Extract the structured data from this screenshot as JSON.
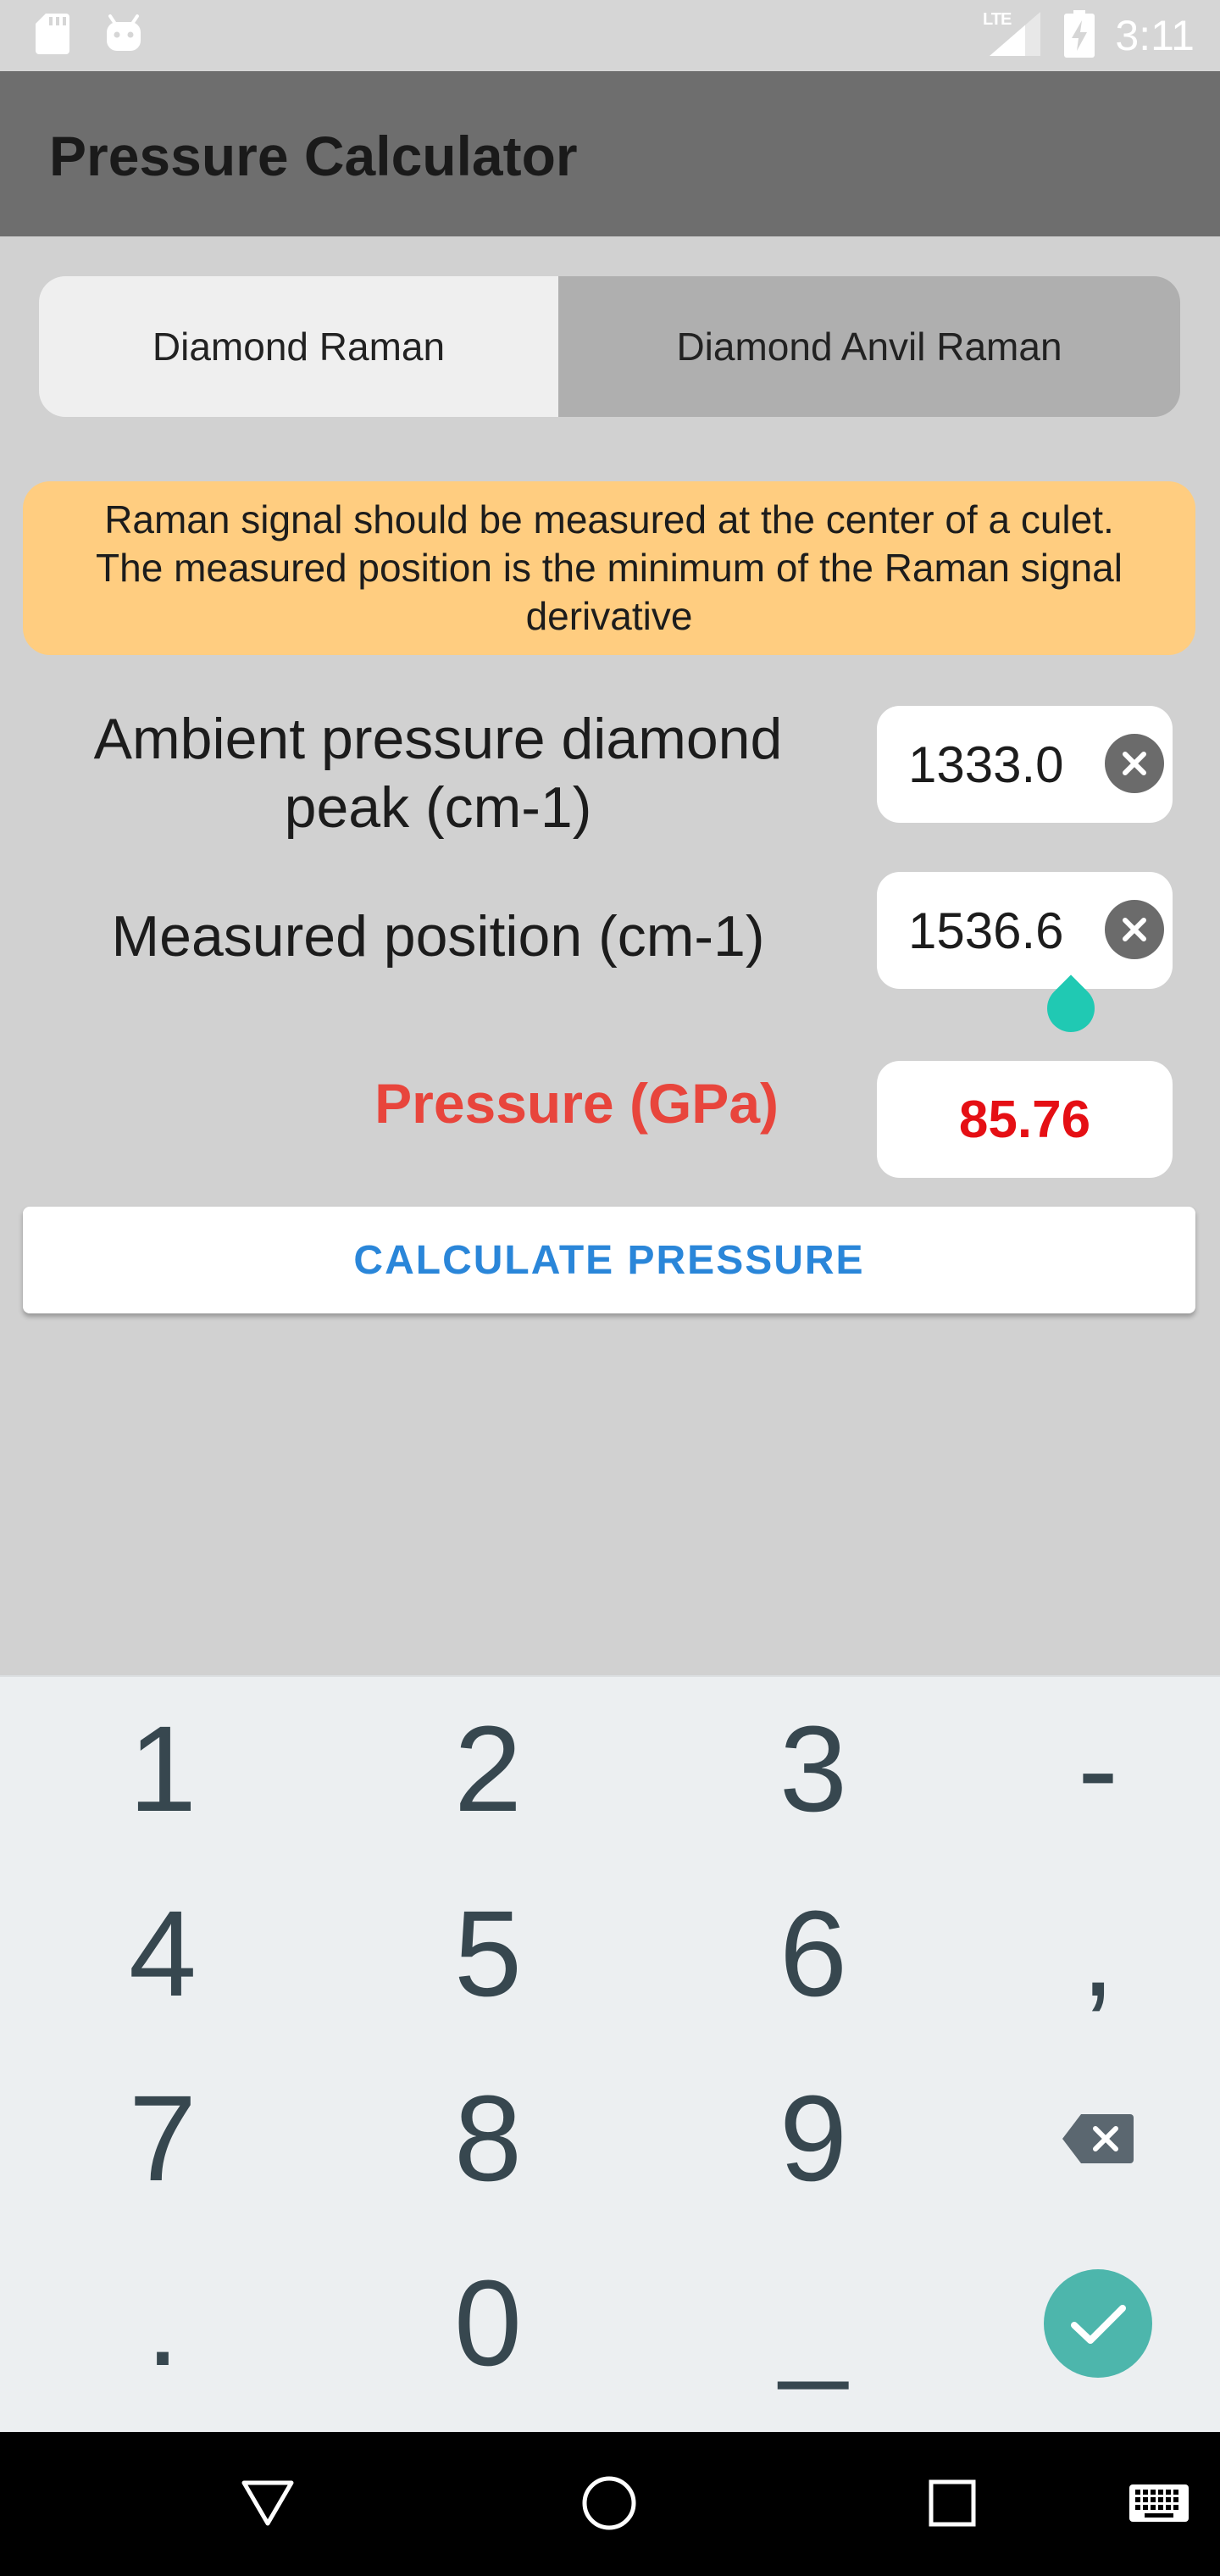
{
  "status_bar": {
    "left_icons": [
      "sd-card-icon",
      "android-icon"
    ],
    "network_label": "LTE",
    "signal_icon": "signal-icon",
    "battery_icon": "battery-charging-icon",
    "time": "3:11"
  },
  "app_bar": {
    "title": "Pressure Calculator"
  },
  "tabs": [
    {
      "label": "Diamond Raman",
      "selected": true
    },
    {
      "label": "Diamond Anvil Raman",
      "selected": false
    }
  ],
  "info": {
    "text": "Raman signal should be measured at the center of a culet. The measured position is the minimum of the Raman signal derivative"
  },
  "form": {
    "fields": [
      {
        "label": "Ambient pressure diamond peak (cm-1)",
        "value": "1333.0",
        "clear_icon": "clear-icon"
      },
      {
        "label": "Measured position (cm-1)",
        "value": "1536.6",
        "clear_icon": "clear-icon",
        "focused": true
      }
    ],
    "result": {
      "label": "Pressure (GPa)",
      "value": "85.76"
    }
  },
  "actions": {
    "calculate_label": "CALCULATE PRESSURE"
  },
  "keyboard": {
    "rows": [
      [
        {
          "label": "1"
        },
        {
          "label": "2"
        },
        {
          "label": "3"
        },
        {
          "label": "-"
        }
      ],
      [
        {
          "label": "4"
        },
        {
          "label": "5"
        },
        {
          "label": "6"
        },
        {
          "label": ","
        }
      ],
      [
        {
          "label": "7"
        },
        {
          "label": "8"
        },
        {
          "label": "9"
        },
        {
          "icon": "backspace-icon"
        }
      ],
      [
        {
          "label": "."
        },
        {
          "label": "0"
        },
        {
          "label": "_"
        },
        {
          "icon": "check-icon"
        }
      ]
    ]
  },
  "nav_bar": {
    "icons": [
      "back-icon",
      "home-icon",
      "recents-icon",
      "keyboard-icon"
    ]
  },
  "colors": {
    "app_bar": "#6e6e6e",
    "info_background": "#ffcd80",
    "result_label": "#e8453c",
    "result_value": "#e50f14",
    "button_text": "#2a86d9",
    "accent": "#4db6ac",
    "cursor_handle": "#20c9b3"
  }
}
